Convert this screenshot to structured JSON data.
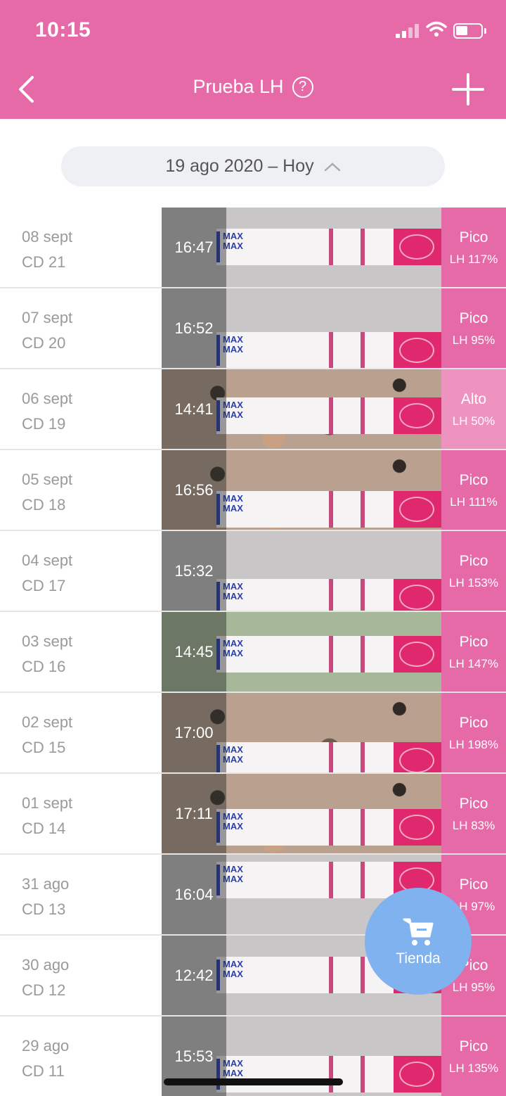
{
  "status_bar": {
    "time": "10:15"
  },
  "nav": {
    "title": "Prueba LH",
    "help_icon": "question-circle-icon",
    "back_icon": "chevron-left-icon",
    "add_icon": "plus-icon"
  },
  "date_range": {
    "label": "19 ago 2020 – Hoy",
    "icon": "chevron-up-icon"
  },
  "colors": {
    "brand_pink": "#e76aa8",
    "alto_pink": "#ee92bf",
    "shop_blue": "#7fb2ef",
    "strip_tip": "#e0286e"
  },
  "tests": [
    {
      "date": "08 sept",
      "cd": "CD 21",
      "time": "16:47",
      "result": "Pico",
      "lh": "LH 117%",
      "bg": "plain"
    },
    {
      "date": "07 sept",
      "cd": "CD 20",
      "time": "16:52",
      "result": "Pico",
      "lh": "LH 95%",
      "bg": "plain"
    },
    {
      "date": "06 sept",
      "cd": "CD 19",
      "time": "14:41",
      "result": "Alto",
      "lh": "LH 50%",
      "bg": "granite"
    },
    {
      "date": "05 sept",
      "cd": "CD 18",
      "time": "16:56",
      "result": "Pico",
      "lh": "LH 111%",
      "bg": "granite"
    },
    {
      "date": "04 sept",
      "cd": "CD 17",
      "time": "15:32",
      "result": "Pico",
      "lh": "LH 153%",
      "bg": "plain"
    },
    {
      "date": "03 sept",
      "cd": "CD 16",
      "time": "14:45",
      "result": "Pico",
      "lh": "LH 147%",
      "bg": "green"
    },
    {
      "date": "02 sept",
      "cd": "CD 15",
      "time": "17:00",
      "result": "Pico",
      "lh": "LH 198%",
      "bg": "granite"
    },
    {
      "date": "01 sept",
      "cd": "CD 14",
      "time": "17:11",
      "result": "Pico",
      "lh": "LH 83%",
      "bg": "granite"
    },
    {
      "date": "31 ago",
      "cd": "CD 13",
      "time": "16:04",
      "result": "Pico",
      "lh": "LH 97%",
      "bg": "plain"
    },
    {
      "date": "30 ago",
      "cd": "CD 12",
      "time": "12:42",
      "result": "Pico",
      "lh": "LH 95%",
      "bg": "plain"
    },
    {
      "date": "29 ago",
      "cd": "CD 11",
      "time": "15:53",
      "result": "Pico",
      "lh": "LH 135%",
      "bg": "plain"
    }
  ],
  "strip_text": "MAX",
  "shop": {
    "label": "Tienda",
    "icon": "shopping-cart-icon"
  }
}
